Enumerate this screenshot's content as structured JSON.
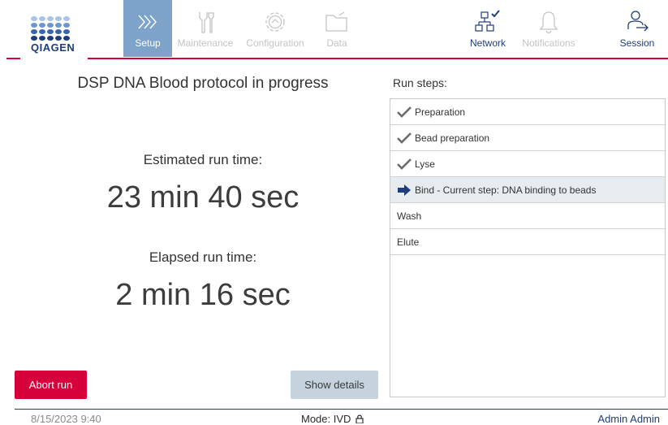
{
  "brand": {
    "logo_text": "QIAGEN",
    "accent_color": "#d6003a",
    "dark_blue": "#1f3d7a",
    "active_tab_color": "#7ea3ca"
  },
  "nav": {
    "setup": {
      "label": "Setup",
      "icon": "chevron-forward-icon",
      "active": true
    },
    "maintenance": {
      "label": "Maintenance",
      "icon": "tools-icon"
    },
    "configuration": {
      "label": "Configuration",
      "icon": "gear-icon"
    },
    "data": {
      "label": "Data",
      "icon": "folder-icon"
    },
    "network": {
      "label": "Network",
      "icon": "network-icon"
    },
    "notifications": {
      "label": "Notifications",
      "icon": "bell-icon"
    },
    "session": {
      "label": "Session",
      "icon": "user-logout-icon"
    }
  },
  "run": {
    "title": "DSP DNA Blood protocol in progress",
    "estimated_label": "Estimated run time:",
    "estimated_value": "23 min 40 sec",
    "elapsed_label": "Elapsed run time:",
    "elapsed_value": "2 min 16 sec"
  },
  "actions": {
    "abort_label": "Abort run",
    "details_label": "Show details"
  },
  "steps": {
    "label": "Run steps:",
    "items": [
      {
        "label": "Preparation",
        "status": "done"
      },
      {
        "label": "Bead preparation",
        "status": "done"
      },
      {
        "label": "Lyse",
        "status": "done"
      },
      {
        "label": "Bind - Current step: DNA binding to beads",
        "status": "current"
      },
      {
        "label": "Wash",
        "status": "pending"
      },
      {
        "label": "Elute",
        "status": "pending"
      }
    ]
  },
  "footer": {
    "datetime": "8/15/2023 9:40",
    "mode": "Mode: IVD",
    "user": "Admin Admin"
  }
}
